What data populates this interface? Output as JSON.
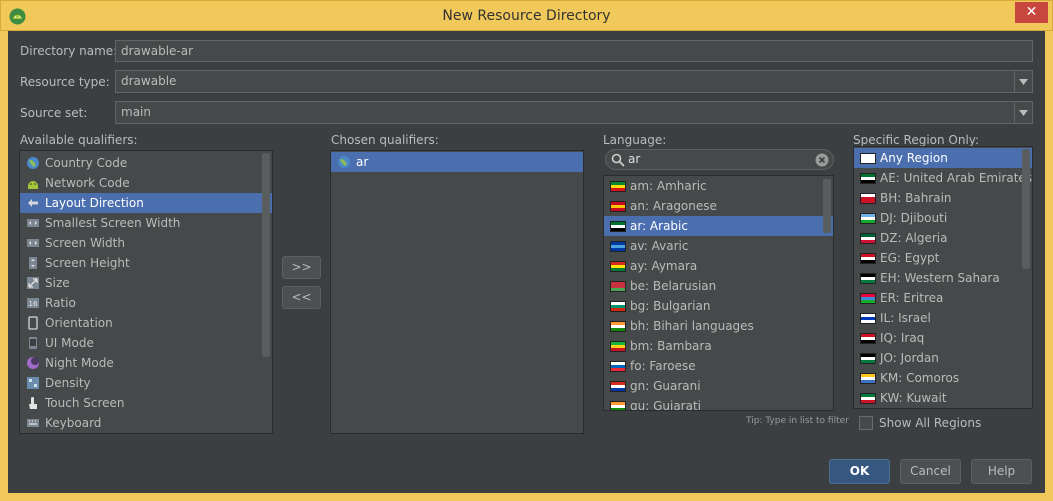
{
  "window": {
    "title": "New Resource Directory"
  },
  "form": {
    "directory_name_label": "Directory name:",
    "directory_name_value": "drawable-ar",
    "resource_type_label": "Resource type:",
    "resource_type_value": "drawable",
    "source_set_label": "Source set:",
    "source_set_value": "main"
  },
  "available": {
    "label": "Available qualifiers:",
    "items": [
      {
        "label": "Country Code",
        "icon": "globe-icon"
      },
      {
        "label": "Network Code",
        "icon": "android-icon"
      },
      {
        "label": "Layout Direction",
        "icon": "layout-direction-icon",
        "selected": true
      },
      {
        "label": "Smallest Screen Width",
        "icon": "screen-width-icon"
      },
      {
        "label": "Screen Width",
        "icon": "screen-width-icon"
      },
      {
        "label": "Screen Height",
        "icon": "screen-height-icon"
      },
      {
        "label": "Size",
        "icon": "size-icon"
      },
      {
        "label": "Ratio",
        "icon": "ratio-icon"
      },
      {
        "label": "Orientation",
        "icon": "orientation-icon"
      },
      {
        "label": "UI Mode",
        "icon": "ui-mode-icon"
      },
      {
        "label": "Night Mode",
        "icon": "night-mode-icon"
      },
      {
        "label": "Density",
        "icon": "density-icon"
      },
      {
        "label": "Touch Screen",
        "icon": "touch-icon"
      },
      {
        "label": "Keyboard",
        "icon": "keyboard-icon"
      }
    ]
  },
  "transfer": {
    "add_label": ">>",
    "remove_label": "<<"
  },
  "chosen": {
    "label": "Chosen qualifiers:",
    "items": [
      {
        "label": "ar",
        "icon": "globe-icon",
        "selected": true
      }
    ]
  },
  "language": {
    "label": "Language:",
    "search_value": "ar",
    "tip": "Tip: Type in list to filter",
    "items": [
      {
        "label": "am: Amharic",
        "flag": [
          "#078930",
          "#fcdd09",
          "#da121a"
        ]
      },
      {
        "label": "an: Aragonese",
        "flag": [
          "#c60b1e",
          "#ffc400",
          "#c60b1e"
        ]
      },
      {
        "label": "ar: Arabic",
        "flag": [
          "#00732f",
          "#ffffff",
          "#000000"
        ],
        "selected": true
      },
      {
        "label": "av: Avaric",
        "flag": [
          "#0039a6",
          "#4aa3df",
          "#0039a6"
        ]
      },
      {
        "label": "ay: Aymara",
        "flag": [
          "#d52b1e",
          "#f9e300",
          "#007934"
        ]
      },
      {
        "label": "be: Belarusian",
        "flag": [
          "#c8313e",
          "#c8313e",
          "#4aa657"
        ]
      },
      {
        "label": "bg: Bulgarian",
        "flag": [
          "#ffffff",
          "#00966e",
          "#d62612"
        ]
      },
      {
        "label": "bh: Bihari languages",
        "flag": [
          "#ff9933",
          "#ffffff",
          "#138808"
        ]
      },
      {
        "label": "bm: Bambara",
        "flag": [
          "#14b53a",
          "#fcd116",
          "#ce1126"
        ]
      },
      {
        "label": "fo: Faroese",
        "flag": [
          "#ffffff",
          "#0065bd",
          "#ed2939"
        ]
      },
      {
        "label": "gn: Guarani",
        "flag": [
          "#d52b1e",
          "#ffffff",
          "#0038a8"
        ]
      },
      {
        "label": "gu: Gujarati",
        "flag": [
          "#ff9933",
          "#ffffff",
          "#138808"
        ]
      }
    ]
  },
  "region": {
    "label": "Specific Region Only:",
    "show_all_label": "Show All Regions",
    "items": [
      {
        "label": "Any Region",
        "flag": [
          "#ffffff",
          "#ffffff",
          "#ffffff"
        ],
        "selected": true
      },
      {
        "label": "AE: United Arab Emirates",
        "flag": [
          "#00732f",
          "#ffffff",
          "#000000"
        ]
      },
      {
        "label": "BH: Bahrain",
        "flag": [
          "#ffffff",
          "#ce1126",
          "#ce1126"
        ]
      },
      {
        "label": "DJ: Djibouti",
        "flag": [
          "#6ab2e7",
          "#ffffff",
          "#12ad2b"
        ]
      },
      {
        "label": "DZ: Algeria",
        "flag": [
          "#006233",
          "#ffffff",
          "#d21034"
        ]
      },
      {
        "label": "EG: Egypt",
        "flag": [
          "#ce1126",
          "#ffffff",
          "#000000"
        ]
      },
      {
        "label": "EH: Western Sahara",
        "flag": [
          "#000000",
          "#ffffff",
          "#007a3d"
        ]
      },
      {
        "label": "ER: Eritrea",
        "flag": [
          "#ea0437",
          "#4189dd",
          "#12ad2b"
        ]
      },
      {
        "label": "IL: Israel",
        "flag": [
          "#ffffff",
          "#0038b8",
          "#ffffff"
        ]
      },
      {
        "label": "IQ: Iraq",
        "flag": [
          "#ce1126",
          "#ffffff",
          "#000000"
        ]
      },
      {
        "label": "JO: Jordan",
        "flag": [
          "#000000",
          "#ffffff",
          "#007a3d"
        ]
      },
      {
        "label": "KM: Comoros",
        "flag": [
          "#ffc61e",
          "#ffffff",
          "#3a75c4"
        ]
      },
      {
        "label": "KW: Kuwait",
        "flag": [
          "#007a3d",
          "#ffffff",
          "#ce1126"
        ]
      }
    ]
  },
  "buttons": {
    "ok": "OK",
    "cancel": "Cancel",
    "help": "Help"
  },
  "colors": {
    "accent": "#4b6eaf",
    "frame": "#f1c85a",
    "background": "#3c3f41"
  }
}
